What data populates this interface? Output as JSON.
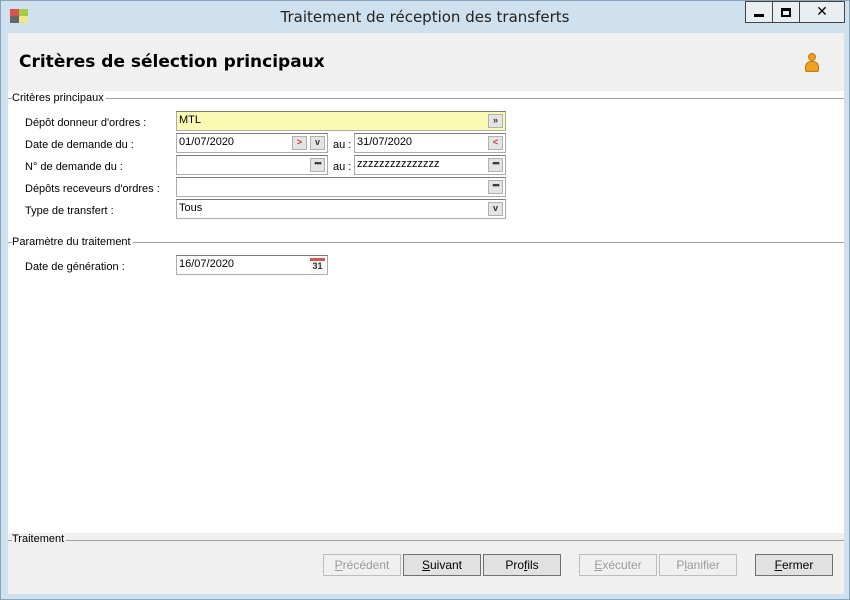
{
  "window": {
    "title": "Traitement de réception des transferts"
  },
  "header": {
    "title": "Critères de sélection principaux"
  },
  "sections": {
    "main": "Critères principaux",
    "params": "Paramètre du traitement",
    "treatment": "Traitement"
  },
  "fields": {
    "depot_donneur": {
      "label": "Dépôt donneur d'ordres :",
      "value": "MTL"
    },
    "date_demande": {
      "label": "Date de demande du :",
      "from": "01/07/2020",
      "to_label": "au :",
      "to": "31/07/2020"
    },
    "num_demande": {
      "label": "N° de demande du :",
      "from": "",
      "to_label": "au :",
      "to": "zzzzzzzzzzzzzzz"
    },
    "depots_receveurs": {
      "label": "Dépôts receveurs d'ordres :",
      "value": ""
    },
    "type_transfert": {
      "label": "Type de transfert :",
      "value": "Tous"
    },
    "date_generation": {
      "label": "Date de génération :",
      "value": "16/07/2020",
      "calendar_day": "31"
    }
  },
  "buttons": {
    "precedent": {
      "u": "P",
      "rest": "récédent"
    },
    "suivant": {
      "u": "S",
      "rest": "uivant"
    },
    "profils": {
      "pre": "Pro",
      "u": "f",
      "rest": "ils"
    },
    "executer": {
      "u": "E",
      "rest": "xécuter"
    },
    "planifier": {
      "pre": "P",
      "u": "l",
      "rest": "anifier"
    },
    "fermer": {
      "u": "F",
      "rest": "ermer"
    }
  },
  "colors": {
    "accent_field": "#fafab4",
    "header_bg": "#f0f0f0",
    "window_frame": "#cfe0ee"
  }
}
